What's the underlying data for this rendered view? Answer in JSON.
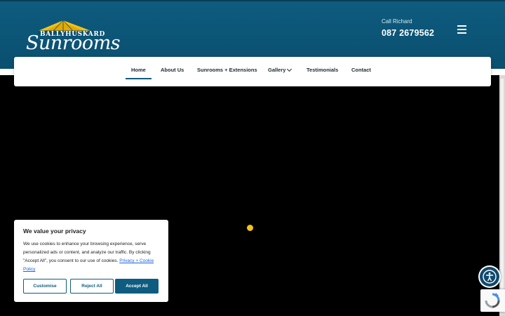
{
  "brand": {
    "name_top": "BALLYHUSKARD",
    "name_main": "Sunrooms"
  },
  "contact": {
    "label": "Call Richard",
    "phone": "087 2679562"
  },
  "nav": {
    "items": [
      {
        "label": "Home",
        "active": true
      },
      {
        "label": "About Us"
      },
      {
        "label": "Sunrooms + Extensions"
      },
      {
        "label": "Gallery",
        "has_dropdown": true
      },
      {
        "label": "Testimonials"
      },
      {
        "label": "Contact"
      }
    ]
  },
  "cookie": {
    "title": "We value your privacy",
    "text": "We use cookies to enhance your browsing experience, serve personalized ads or content, and analyze our traffic. By clicking \"Accept All\", you consent to our use of cookies.",
    "link": "Privacy + Cookie Policy",
    "buttons": {
      "customise": "Customise",
      "reject": "Reject All",
      "accept": "Accept All"
    }
  },
  "colors": {
    "header": "#0e5c7f",
    "accent_yellow": "#f3c317",
    "hero": "#000000"
  },
  "icons": {
    "menu": "hamburger-icon",
    "accessibility": "accessibility-icon",
    "recaptcha": "recaptcha-icon",
    "dropdown": "chevron-down-icon"
  }
}
